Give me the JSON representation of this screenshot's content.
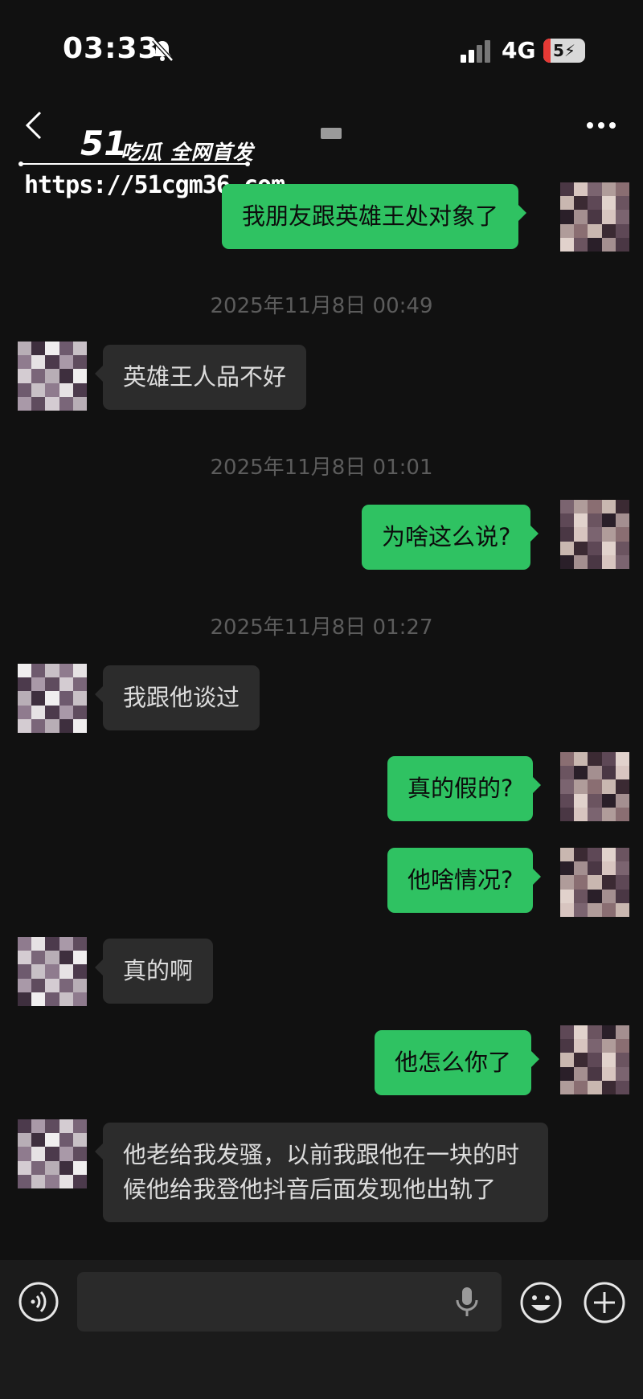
{
  "status_bar": {
    "time": "03:33",
    "network": "4G",
    "battery": "5"
  },
  "header": {
    "back_icon": "chevron-left-icon",
    "more_icon": "ellipsis-icon"
  },
  "watermark": {
    "logo": "51",
    "slogan": "吃瓜 全网首发",
    "url": "https://51cgm36.com"
  },
  "messages": [
    {
      "from": "me",
      "text": "我朋友跟英雄王处对象了"
    },
    {
      "type": "timestamp",
      "text": "2025年11月8日 00:49"
    },
    {
      "from": "them",
      "text": "英雄王人品不好"
    },
    {
      "type": "timestamp",
      "text": "2025年11月8日 01:01"
    },
    {
      "from": "me",
      "text": "为啥这么说?"
    },
    {
      "type": "timestamp",
      "text": "2025年11月8日 01:27"
    },
    {
      "from": "them",
      "text": "我跟他谈过"
    },
    {
      "from": "me",
      "text": "真的假的?"
    },
    {
      "from": "me",
      "text": "他啥情况?"
    },
    {
      "from": "them",
      "text": "真的啊"
    },
    {
      "from": "me",
      "text": "他怎么你了"
    },
    {
      "from": "them",
      "text": "他老给我发骚，以前我跟他在一块的时候他给我登他抖音后面发现他出轨了"
    }
  ],
  "input_bar": {
    "voice_icon": "voice-icon",
    "mic_icon": "mic-icon",
    "emoji_icon": "emoji-icon",
    "plus_icon": "plus-icon"
  },
  "colors": {
    "background": "#111111",
    "my_bubble": "#2fc262",
    "their_bubble": "#2c2c2c",
    "timestamp": "#5c5c5c"
  }
}
